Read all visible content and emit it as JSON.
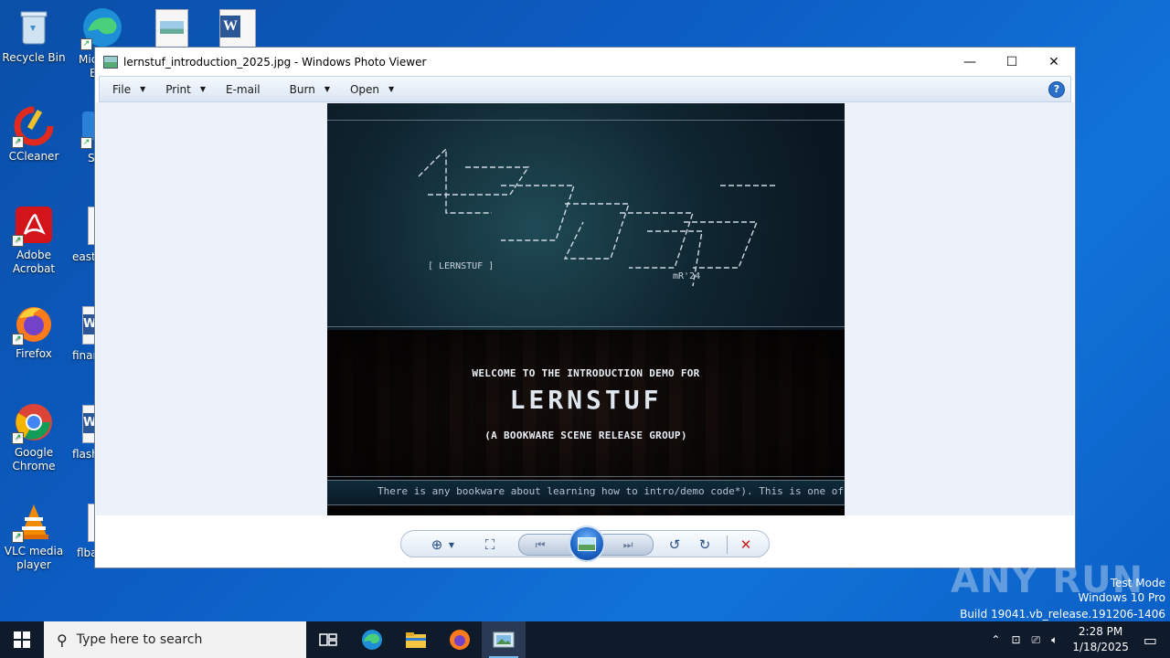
{
  "desktop": {
    "icons": [
      {
        "label": "Recycle Bin",
        "icon": "recycle-bin-icon"
      },
      {
        "label": "CCleaner",
        "icon": "ccleaner-icon"
      },
      {
        "label": "Adobe Acrobat",
        "icon": "adobe-acrobat-icon"
      },
      {
        "label": "Firefox",
        "icon": "firefox-icon"
      },
      {
        "label": "Google Chrome",
        "icon": "chrome-icon"
      },
      {
        "label": "VLC media player",
        "icon": "vlc-icon"
      }
    ],
    "partial_labels": [
      "Mic",
      "E",
      "Sl",
      "easto",
      "finan",
      "flash",
      "flba"
    ]
  },
  "window": {
    "title": "lernstuf_introduction_2025.jpg - Windows Photo Viewer",
    "controls": {
      "minimize": "—",
      "maximize": "☐",
      "close": "✕"
    },
    "menu": [
      {
        "label": "File",
        "dropdown": true
      },
      {
        "label": "Print",
        "dropdown": true
      },
      {
        "label": "E-mail",
        "dropdown": false
      },
      {
        "label": "Burn",
        "dropdown": true
      },
      {
        "label": "Open",
        "dropdown": true
      }
    ],
    "help": "?"
  },
  "image": {
    "tag": "[ LERNSTUF ]",
    "signature": "mR'24",
    "welcome": "WELCOME TO THE INTRODUCTION DEMO FOR",
    "logo_small": "LERNSTUF",
    "subtitle": "(A BOOKWARE SCENE RELEASE GROUP)",
    "ticker": "There is any bookware about learning how to intro/demo code*). This is one of on"
  },
  "toolbar": {
    "zoom": "zoom-icon",
    "fit": "actual-size-icon",
    "prev": "previous-icon",
    "slideshow": "slideshow-icon",
    "next": "next-icon",
    "rotate_ccw": "rotate-counterclockwise-icon",
    "rotate_cw": "rotate-clockwise-icon",
    "delete": "delete-icon"
  },
  "watermark": {
    "brand": "ANY RUN",
    "line1": "Test Mode",
    "line2": "Windows 10 Pro",
    "line3": "Build 19041.vb_release.191206-1406"
  },
  "taskbar": {
    "search_placeholder": "Type here to search",
    "time": "2:28 PM",
    "date": "1/18/2025"
  }
}
